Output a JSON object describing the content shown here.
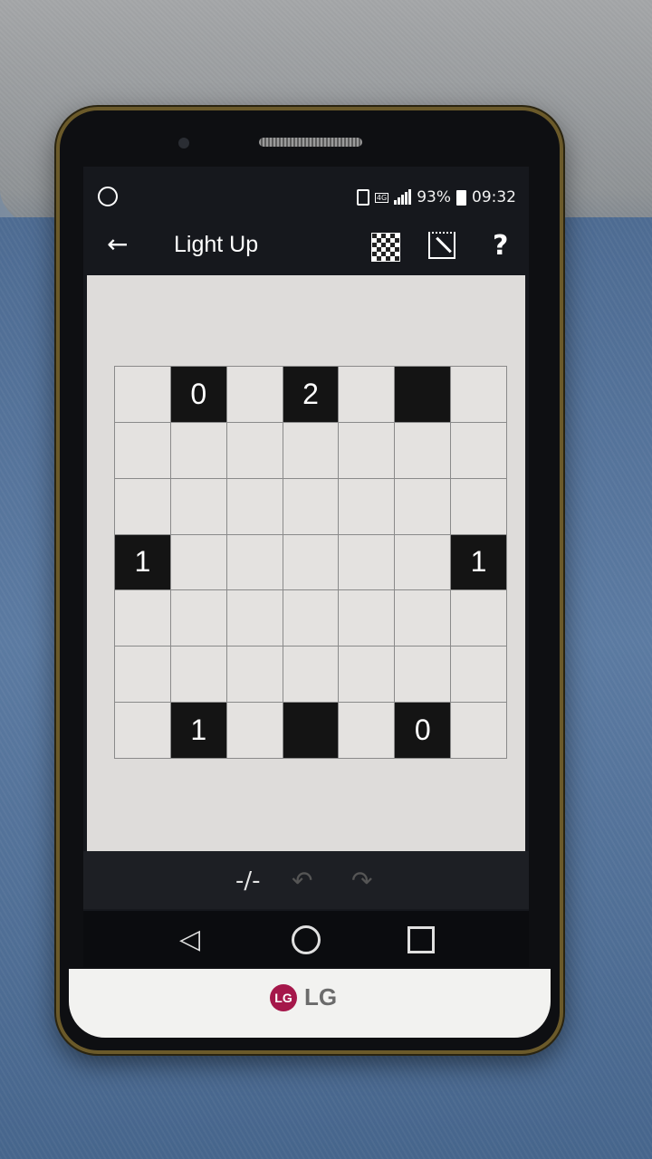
{
  "status": {
    "battery": "93%",
    "time": "09:32",
    "network": "4G"
  },
  "appbar": {
    "title": "Light Up"
  },
  "icons": {
    "back": "←",
    "help": "?",
    "toggle": "⁄",
    "undo": "↶",
    "redo": "↷",
    "nav_back": "◁"
  },
  "puzzle": {
    "rows": 7,
    "cols": 7,
    "cells": [
      [
        "",
        "0",
        "",
        "2",
        "",
        "#",
        ""
      ],
      [
        "",
        "",
        "",
        "",
        "",
        "",
        ""
      ],
      [
        "",
        "",
        "",
        "",
        "",
        "",
        ""
      ],
      [
        "1",
        "",
        "",
        "",
        "",
        "",
        "1"
      ],
      [
        "",
        "",
        "",
        "",
        "",
        "",
        ""
      ],
      [
        "",
        "",
        "",
        "",
        "",
        "",
        ""
      ],
      [
        "",
        "1",
        "",
        "#",
        "",
        "0",
        ""
      ]
    ]
  },
  "brand": {
    "logo_text": "LG",
    "logo_mark": "LG"
  }
}
